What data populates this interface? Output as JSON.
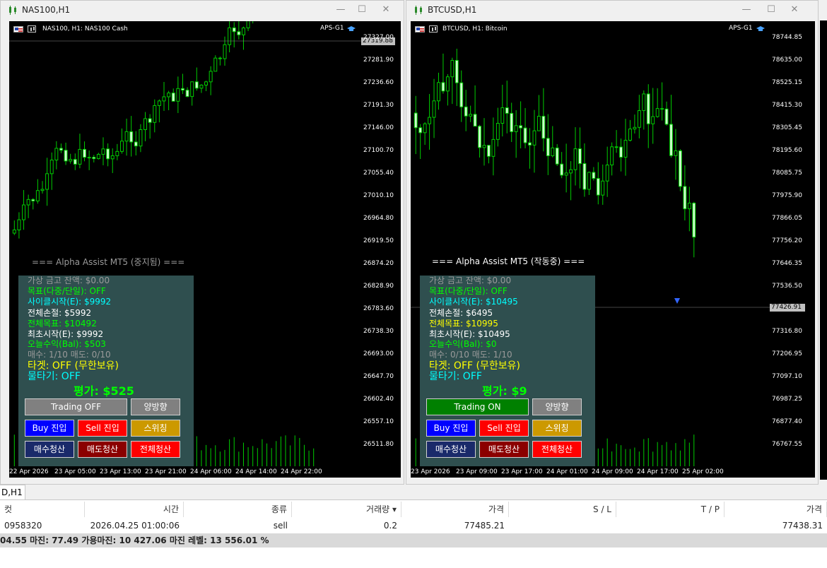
{
  "colors": {
    "bull_candle": "#00cc00",
    "bull_body": "#ccffcc",
    "panel_bg": "#2f4f4f",
    "buy_btn": "#0000ff",
    "sell_btn": "#ff0000",
    "swing_btn": "#cc9900",
    "close_buy_btn": "#1a2a6a",
    "close_sell_btn": "#8b0000",
    "close_all_btn": "#ff0000",
    "trading_on": "#008000",
    "trading_off": "#808080"
  },
  "windows": [
    {
      "title": "NAS100,H1",
      "chart_label": "NAS100, H1:  NAS100 Cash",
      "indicator": "APS-G1",
      "current_price": "27319.88",
      "price_labels": [
        "27327.00",
        "27281.90",
        "27236.60",
        "27191.30",
        "27146.00",
        "27100.70",
        "27055.40",
        "27010.10",
        "26964.80",
        "26919.50",
        "26874.20",
        "26828.90",
        "26783.60",
        "26738.30",
        "26693.00",
        "26647.70",
        "26602.40",
        "26557.10",
        "26511.80"
      ],
      "time_labels": [
        "22 Apr 2026",
        "23 Apr 05:00",
        "23 Apr 13:00",
        "23 Apr 21:00",
        "24 Apr 06:00",
        "24 Apr 14:00",
        "24 Apr 22:00"
      ],
      "panel": {
        "heading": "=== Alpha Assist MT5 (중지됨) ===",
        "virtual_balance": "가상 금고 잔액: $0.00",
        "target_mode": "목표(다중/단일): OFF",
        "cycle_start": "사이클시작(E): $9992",
        "total_loss": "전체손절: $5992",
        "total_target": "전체목표: $10492",
        "initial_start": "최초시작(E): $9992",
        "today_profit": "오늘수익(Bal): $503",
        "counts": "매수: 1/10   매도: 0/10",
        "target": "타겟: OFF (무한보유)",
        "water": "물타기: OFF",
        "evaluation": "평가: $525",
        "trading_btn": "Trading OFF",
        "trading_on": false,
        "bidir_btn": "양방향",
        "buy_btn": "Buy 진입",
        "sell_btn": "Sell 진입",
        "swing_btn": "스위칭",
        "close_buy_btn": "매수청산",
        "close_sell_btn": "매도청산",
        "close_all_btn": "전체청산"
      }
    },
    {
      "title": "BTCUSD,H1",
      "chart_label": "BTCUSD, H1:  Bitcoin",
      "indicator": "APS-G1",
      "current_price": "77426.91",
      "price_labels": [
        "78744.85",
        "78635.00",
        "78525.15",
        "78415.30",
        "78305.45",
        "78195.60",
        "78085.75",
        "77975.90",
        "77866.05",
        "77756.20",
        "77646.35",
        "77536.50",
        "77426.91",
        "77316.80",
        "77206.95",
        "77097.10",
        "76987.25",
        "76877.40",
        "76767.55"
      ],
      "time_labels": [
        "23 Apr 2026",
        "23 Apr 09:00",
        "23 Apr 17:00",
        "24 Apr 01:00",
        "24 Apr 09:00",
        "24 Apr 17:00",
        "25 Apr 02:00"
      ],
      "panel": {
        "heading": "=== Alpha Assist MT5 (작동중) ===",
        "virtual_balance": "가상 금고 잔액: $0.00",
        "target_mode": "목표(다중/단일): OFF",
        "cycle_start": "사이클시작(E): $10495",
        "total_loss": "전체손절: $6495",
        "total_target": "전체목표: $10995",
        "initial_start": "최초시작(E): $10495",
        "today_profit": "오늘수익(Bal): $0",
        "counts": "매수: 0/10   매도: 1/10",
        "target": "타겟: OFF (무한보유)",
        "water": "물타기: OFF",
        "evaluation": "평가: $9",
        "trading_btn": "Trading ON",
        "trading_on": true,
        "bidir_btn": "양방향",
        "buy_btn": "Buy 진입",
        "sell_btn": "Sell 진입",
        "swing_btn": "스위칭",
        "close_buy_btn": "매수청산",
        "close_sell_btn": "매도청산",
        "close_all_btn": "전체청산"
      }
    }
  ],
  "bottom": {
    "tab": "D,H1",
    "headers": [
      "컷",
      "시간",
      "종류",
      "거래량 ▾",
      "가격",
      "S / L",
      "T / P",
      "가격"
    ],
    "row": [
      "0958320",
      "2026.04.25 01:00:06",
      "sell",
      "0.2",
      "77485.21",
      "",
      "",
      "77438.31"
    ],
    "status": "04.55  마진: 77.49  가용마진: 10 427.06  마진 레벨: 13 556.01 %"
  }
}
